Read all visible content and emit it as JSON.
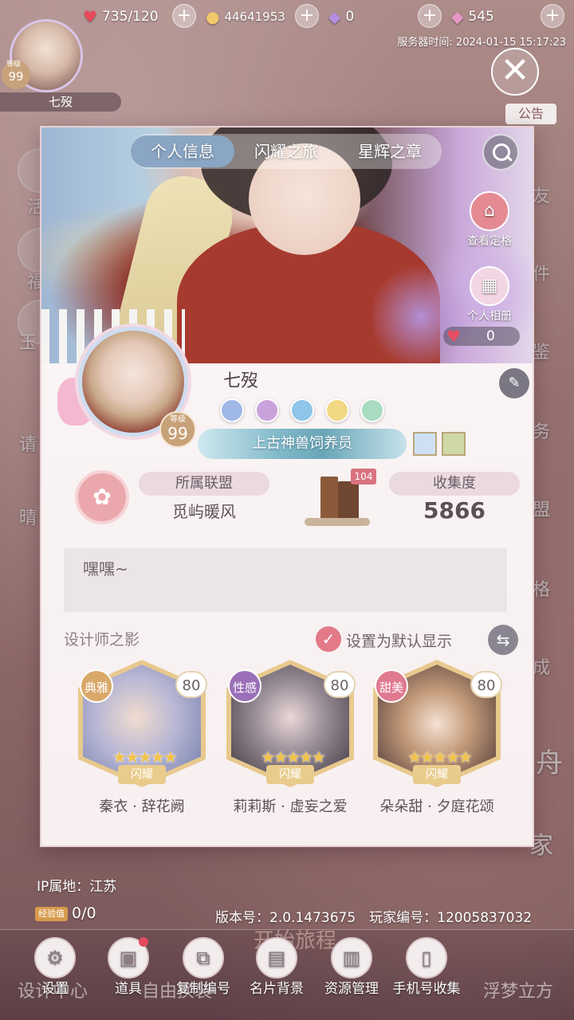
{
  "status_bar": {
    "stamina": "735/120",
    "coins": "44641953",
    "diamonds": "0",
    "stars": "545",
    "plus_label": "+",
    "server_time_label": "服务器时间:",
    "server_time": "2024-01-15 15:17:23"
  },
  "player": {
    "name": "七歿",
    "level": "99",
    "level_label": "等级"
  },
  "announcement": "公告",
  "close_glyph": "✕",
  "background": {
    "left_items": [
      "活",
      "福",
      "玉",
      "请",
      "晴"
    ],
    "right_items": [
      "友",
      "件",
      "鉴",
      "务",
      "盟",
      "格",
      "成",
      "舟",
      "家"
    ]
  },
  "card": {
    "tabs": [
      {
        "label": "个人信息",
        "active": true
      },
      {
        "label": "闪耀之旅",
        "active": false
      },
      {
        "label": "星辉之章",
        "active": false
      }
    ],
    "actions": {
      "view_pose": "查看定格",
      "album": "个人相册"
    },
    "likes": "0",
    "title_badge": "上古神兽饲养员",
    "alliance": {
      "label": "所属联盟",
      "name": "觅屿暖风"
    },
    "collection": {
      "label": "收集度",
      "value": "5866",
      "books_count": "104"
    },
    "signature": "嘿嘿~",
    "designer_section": {
      "title": "设计师之影",
      "default_label": "设置为默认显示",
      "designers": [
        {
          "tag": "典雅",
          "level": "80",
          "rank": "闪耀",
          "name": "秦衣 · 辞花阙",
          "tag_color": "#d9a96a"
        },
        {
          "tag": "性感",
          "level": "80",
          "rank": "闪耀",
          "name": "莉莉斯 · 虚妄之爱",
          "tag_color": "#9a6fb8"
        },
        {
          "tag": "甜美",
          "level": "80",
          "rank": "闪耀",
          "name": "朵朵甜 · 夕庭花颂",
          "tag_color": "#e07a8f"
        }
      ]
    }
  },
  "footer": {
    "ip_location": "IP属地：江苏",
    "exp_tag": "经验值",
    "exp_value": "0/0",
    "version": "版本号：2.0.1473675　玩家编号：12005837032"
  },
  "toolbar": {
    "background_labels": [
      "设计中心",
      "自由换装",
      "开始旅程",
      "浮梦立方"
    ],
    "items": [
      {
        "label": "设置",
        "icon": "gear-icon",
        "glyph": "⚙"
      },
      {
        "label": "道具",
        "icon": "bag-icon",
        "glyph": "▣"
      },
      {
        "label": "复制编号",
        "icon": "copy-icon",
        "glyph": "⧉"
      },
      {
        "label": "名片背景",
        "icon": "card-icon",
        "glyph": "▤"
      },
      {
        "label": "资源管理",
        "icon": "folder-icon",
        "glyph": "▥"
      },
      {
        "label": "手机号收集",
        "icon": "phone-icon",
        "glyph": "▯"
      }
    ]
  }
}
